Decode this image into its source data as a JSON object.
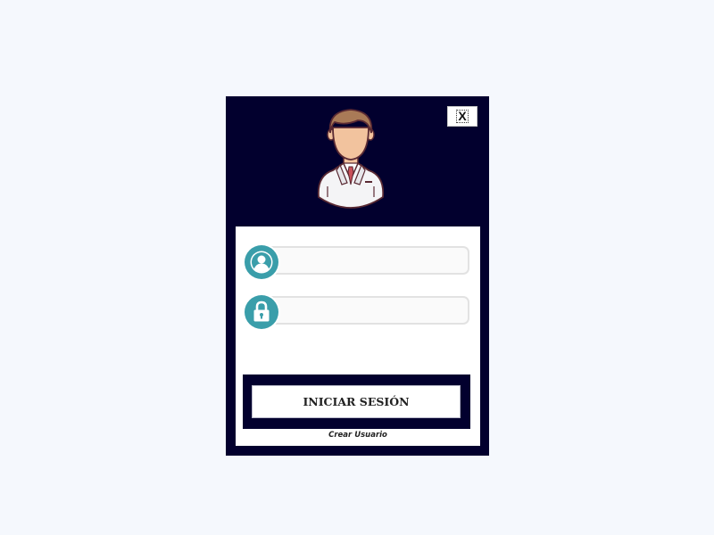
{
  "window": {
    "close_label": "X"
  },
  "login": {
    "username": {
      "value": "",
      "placeholder": ""
    },
    "password": {
      "value": "",
      "placeholder": ""
    },
    "submit_label": "INICIAR SESIÓN",
    "create_user_label": "Crear Usuario"
  },
  "icons": {
    "avatar": "doctor-avatar-icon",
    "username": "user-icon",
    "password": "lock-icon",
    "close": "close-icon"
  },
  "colors": {
    "page_background": "#f5f8fd",
    "dialog_background": "#02002e",
    "icon_badge": "#3a9eaa",
    "panel": "#ffffff"
  }
}
